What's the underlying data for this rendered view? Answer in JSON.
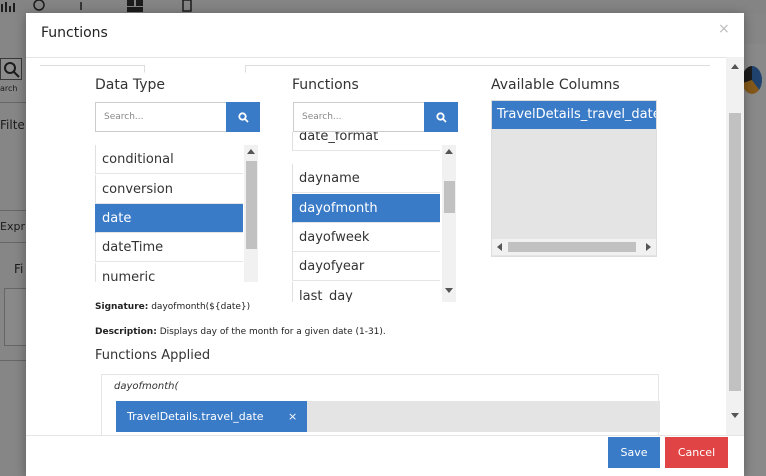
{
  "background": {
    "search_label": "arch",
    "filter_label": "Filte",
    "expr_label": "Expr",
    "f_label": "Fi"
  },
  "modal": {
    "title": "Functions",
    "close_symbol": "×"
  },
  "data_type": {
    "label": "Data Type",
    "search_placeholder": "Search...",
    "items": [
      {
        "label": "conditional",
        "selected": false
      },
      {
        "label": "conversion",
        "selected": false
      },
      {
        "label": "date",
        "selected": true
      },
      {
        "label": "dateTime",
        "selected": false
      },
      {
        "label": "numeric",
        "selected": false
      }
    ]
  },
  "functions": {
    "label": "Functions",
    "search_placeholder": "Search...",
    "items": [
      {
        "label": "date_format",
        "selected": false
      },
      {
        "label": "dayname",
        "selected": false
      },
      {
        "label": "dayofmonth",
        "selected": true
      },
      {
        "label": "dayofweek",
        "selected": false
      },
      {
        "label": "dayofyear",
        "selected": false
      },
      {
        "label": "last_day",
        "selected": false
      }
    ]
  },
  "available_columns": {
    "label": "Available Columns",
    "items": [
      {
        "label": "TravelDetails_travel_date",
        "selected": true
      }
    ]
  },
  "signature": {
    "label": "Signature:",
    "value": "dayofmonth(${date})"
  },
  "description": {
    "label": "Description:",
    "value": "Displays day of the month for a given date (1-31)."
  },
  "functions_applied": {
    "label": "Functions Applied",
    "expression": "dayofmonth(",
    "chips": [
      {
        "label": "TravelDetails.travel_date",
        "remove_symbol": "×"
      }
    ]
  },
  "footer": {
    "save_label": "Save",
    "cancel_label": "Cancel"
  },
  "colors": {
    "accent": "#3a7bc8",
    "cancel": "#e04444"
  }
}
